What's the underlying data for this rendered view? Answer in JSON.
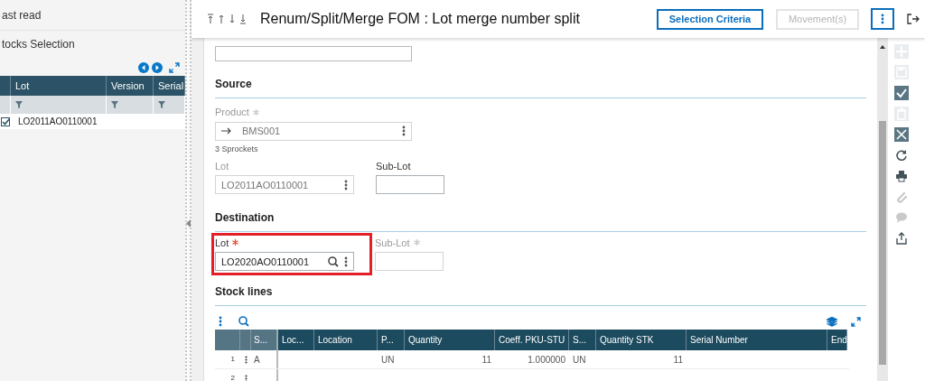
{
  "left_panel": {
    "last_read": "ast read",
    "section_title": "tocks Selection",
    "grid": {
      "columns": [
        "Lot",
        "Version",
        "Serial"
      ],
      "rows": [
        {
          "checked": true,
          "lot": "LO2011AO0110001"
        }
      ]
    }
  },
  "header": {
    "title": "Renum/Split/Merge FOM : Lot merge number split",
    "buttons": [
      {
        "label": "Selection Criteria",
        "disabled": false
      },
      {
        "label": "Movement(s)",
        "disabled": true
      }
    ]
  },
  "source": {
    "title": "Source",
    "product": {
      "label": "Product",
      "required": true,
      "disabled": true,
      "value": "BMS001",
      "description": "3 Sprockets"
    },
    "lot": {
      "label": "Lot",
      "disabled": true,
      "value": "LO2011AO0110001"
    },
    "sub_lot": {
      "label": "Sub-Lot",
      "disabled": false
    }
  },
  "destination": {
    "title": "Destination",
    "lot": {
      "label": "Lot",
      "required": true,
      "disabled": false,
      "value": "LO2020AO0110001",
      "highlighted": true
    },
    "sub_lot": {
      "label": "Sub-Lot",
      "required": true,
      "disabled": true
    }
  },
  "stock_lines": {
    "title": "Stock lines",
    "frozen_columns": [
      "S..."
    ],
    "columns": [
      {
        "label": "Loc...",
        "kind": "text"
      },
      {
        "label": "Location",
        "kind": "text"
      },
      {
        "label": "P...",
        "kind": "text"
      },
      {
        "label": "Quantity",
        "kind": "number"
      },
      {
        "label": "Coeff. PKU-STU",
        "kind": "number"
      },
      {
        "label": "S...",
        "kind": "text"
      },
      {
        "label": "Quantity STK",
        "kind": "number"
      },
      {
        "label": "Serial Number",
        "kind": "text"
      },
      {
        "label": "End",
        "kind": "text"
      }
    ],
    "rows": [
      {
        "number": "1",
        "frozen": [
          "A"
        ],
        "cells": [
          null,
          null,
          "UN",
          "11",
          "1.000000",
          "UN",
          "11",
          null,
          null
        ]
      },
      {
        "number": "2"
      }
    ]
  },
  "toolbar": [
    {
      "kind": "add",
      "disabled": true
    },
    {
      "kind": "save",
      "disabled": true
    },
    {
      "kind": "check",
      "disabled": false
    },
    {
      "kind": "delete",
      "disabled": true
    },
    {
      "kind": "close",
      "disabled": false
    },
    {
      "kind": "refresh",
      "disabled": false
    },
    {
      "kind": "print",
      "disabled": false
    },
    {
      "kind": "attach",
      "disabled": true
    },
    {
      "kind": "comment",
      "disabled": true
    },
    {
      "kind": "share",
      "disabled": false
    }
  ]
}
